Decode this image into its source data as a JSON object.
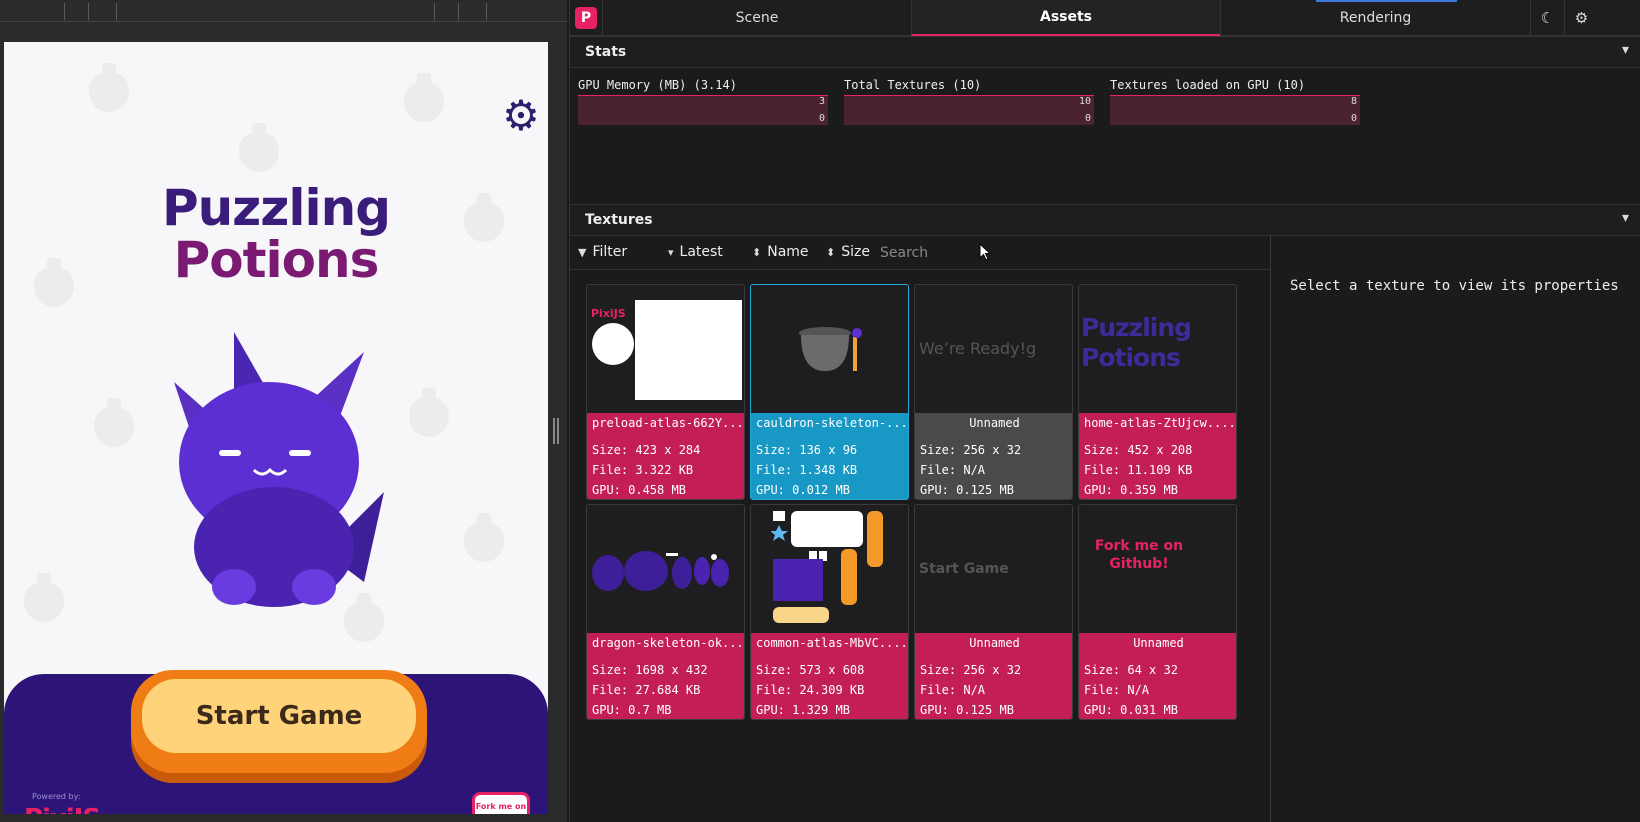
{
  "game": {
    "title_line1": "Puzzling",
    "title_line2": "Potions",
    "start_button": "Start Game",
    "powered_by": "Powered by:",
    "pixi_logo": "PixiJS",
    "fork_badge": "Fork me on Github!",
    "settings_icon": "gear-icon"
  },
  "devtools": {
    "logo": "P",
    "tabs": [
      {
        "label": "Scene"
      },
      {
        "label": "Assets"
      },
      {
        "label": "Rendering"
      }
    ],
    "active_tab": "Assets",
    "theme_icon": "moon-icon",
    "settings_icon": "gear-icon",
    "accent_color": "#e72264",
    "selected_color": "#1898c4"
  },
  "stats": {
    "title": "Stats",
    "chevron": "⌄",
    "items": [
      {
        "label": "GPU Memory (MB) (3.14)",
        "max": "3",
        "min": "0"
      },
      {
        "label": "Total Textures (10)",
        "max": "10",
        "min": "0"
      },
      {
        "label": "Textures loaded on GPU (10)",
        "max": "8",
        "min": "0"
      }
    ]
  },
  "textures": {
    "title": "Textures",
    "chevron": "⌄",
    "toolbar": {
      "filter": "Filter",
      "latest": "Latest",
      "name": "Name",
      "size": "Size",
      "search_placeholder": "Search"
    },
    "empty_message": "Select a texture to view its properties",
    "cards": [
      {
        "name": "preload-atlas-662Y...",
        "size": "Size: 423 x 284",
        "file": "File: 3.322 KB",
        "gpu": "GPU: 0.458 MB",
        "thumb_text": "PixiJS"
      },
      {
        "name": "cauldron-skeleton-...",
        "size": "Size: 136 x 96",
        "file": "File: 1.348 KB",
        "gpu": "GPU: 0.012 MB",
        "thumb_text": ""
      },
      {
        "name": "Unnamed",
        "size": "Size: 256 x 32",
        "file": "File: N/A",
        "gpu": "GPU: 0.125 MB",
        "thumb_text": "We’re Ready!g"
      },
      {
        "name": "home-atlas-ZtUjcw....",
        "size": "Size: 452 x 208",
        "file": "File: 11.109 KB",
        "gpu": "GPU: 0.359 MB",
        "thumb_text": "Puzzling Potions"
      },
      {
        "name": "dragon-skeleton-ok...",
        "size": "Size: 1698 x 432",
        "file": "File: 27.684 KB",
        "gpu": "GPU: 0.7 MB",
        "thumb_text": ""
      },
      {
        "name": "common-atlas-MbVC....",
        "size": "Size: 573 x 608",
        "file": "File: 24.309 KB",
        "gpu": "GPU: 1.329 MB",
        "thumb_text": ""
      },
      {
        "name": "Unnamed",
        "size": "Size: 256 x 32",
        "file": "File: N/A",
        "gpu": "GPU: 0.125 MB",
        "thumb_text": "Start Game"
      },
      {
        "name": "Unnamed",
        "size": "Size: 64 x 32",
        "file": "File: N/A",
        "gpu": "GPU: 0.031 MB",
        "thumb_text": "Fork me on Github!"
      }
    ]
  }
}
